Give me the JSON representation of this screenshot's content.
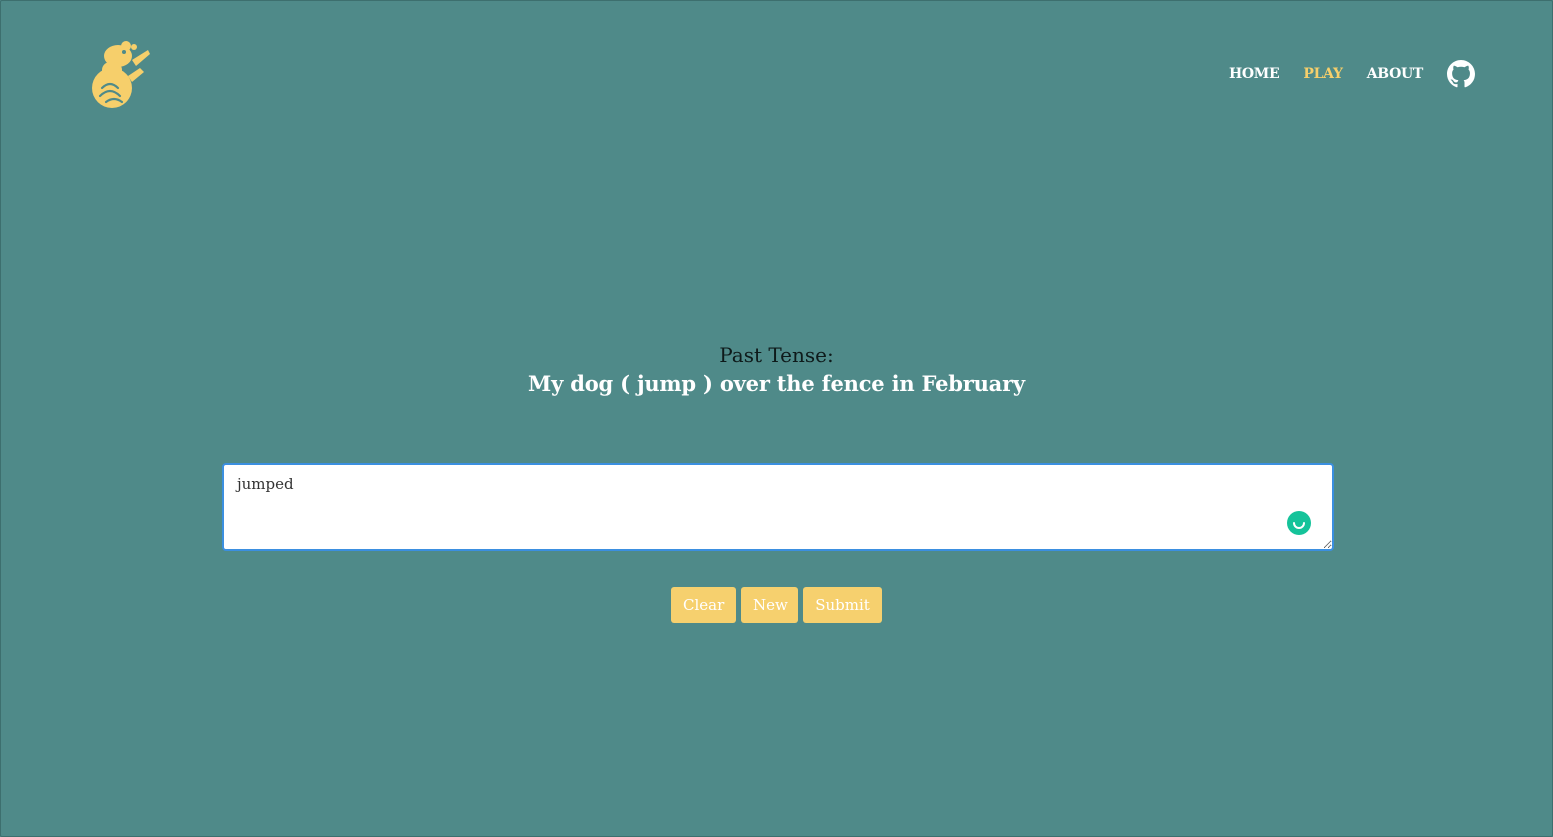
{
  "nav": {
    "items": [
      {
        "label": "HOME",
        "active": false
      },
      {
        "label": "PLAY",
        "active": true
      },
      {
        "label": "ABOUT",
        "active": false
      }
    ],
    "github_icon": "github-icon"
  },
  "logo": {
    "icon": "dinosaur-logo-icon"
  },
  "prompt": {
    "label": "Past Tense:",
    "sentence": "My dog ( jump ) over the fence in February"
  },
  "answer": {
    "value": "jumped"
  },
  "buttons": {
    "clear_label": "Clear",
    "new_label": "New",
    "submit_label": "Submit"
  },
  "colors": {
    "background": "#4f8a89",
    "accent": "#f6d06e",
    "nav_active": "#f6cf6b",
    "input_border": "#3b8fe0",
    "grammarly": "#15c39a"
  }
}
